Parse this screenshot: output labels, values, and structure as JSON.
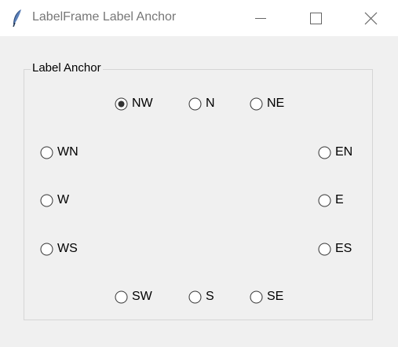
{
  "window": {
    "title": "LabelFrame Label Anchor"
  },
  "labelframe": {
    "label": "Label Anchor"
  },
  "options": {
    "nw": {
      "label": "NW",
      "selected": true
    },
    "n": {
      "label": "N",
      "selected": false
    },
    "ne": {
      "label": "NE",
      "selected": false
    },
    "wn": {
      "label": "WN",
      "selected": false
    },
    "en": {
      "label": "EN",
      "selected": false
    },
    "w": {
      "label": "W",
      "selected": false
    },
    "e": {
      "label": "E",
      "selected": false
    },
    "ws": {
      "label": "WS",
      "selected": false
    },
    "es": {
      "label": "ES",
      "selected": false
    },
    "sw": {
      "label": "SW",
      "selected": false
    },
    "s": {
      "label": "S",
      "selected": false
    },
    "se": {
      "label": "SE",
      "selected": false
    }
  }
}
